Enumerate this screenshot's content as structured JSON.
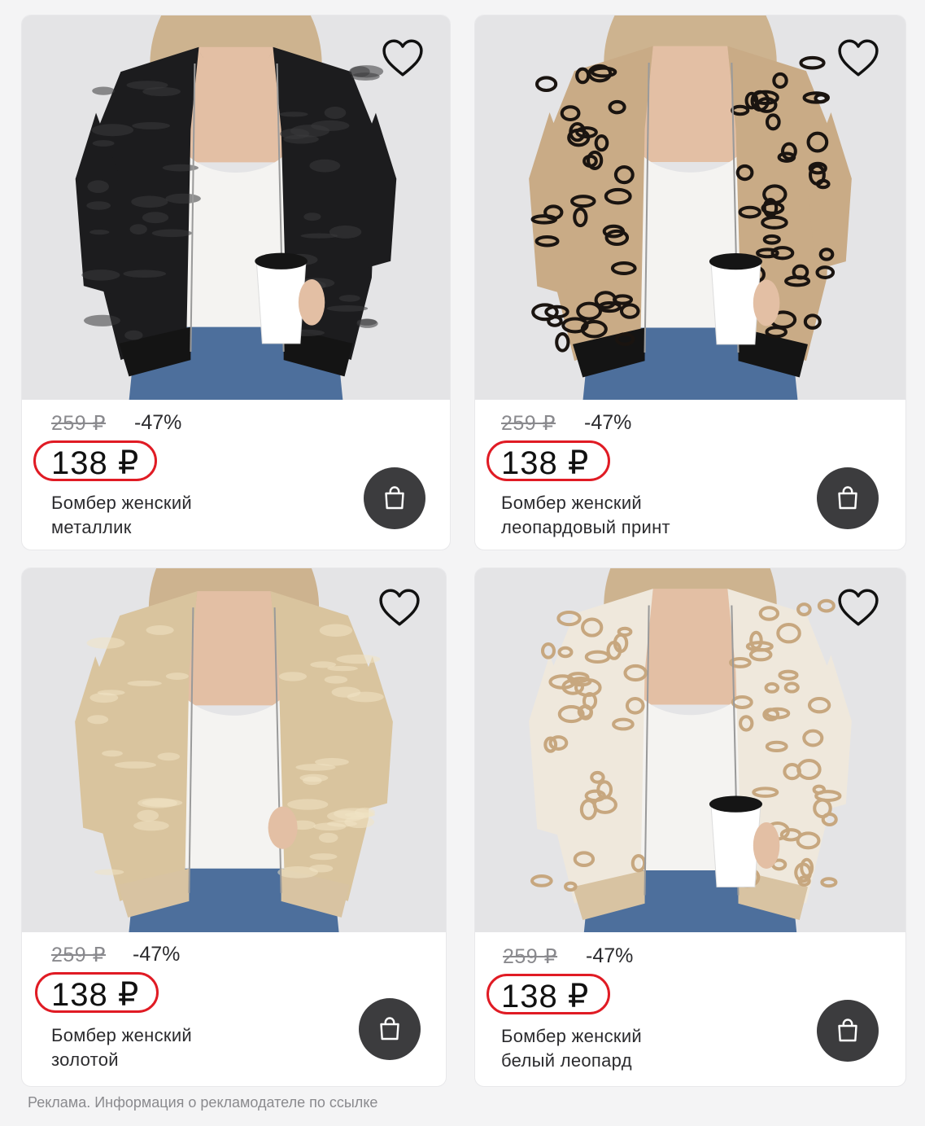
{
  "products": [
    {
      "old_price": "259 ₽",
      "discount": "-47%",
      "price": "138 ₽",
      "title_line1": "Бомбер женский",
      "title_line2": "металлик",
      "jacket_color": "#1c1c1e",
      "jacket_pattern": "metallic",
      "cup": true
    },
    {
      "old_price": "259 ₽",
      "discount": "-47%",
      "price": "138 ₽",
      "title_line1": "Бомбер женский",
      "title_line2": "леопардовый принт",
      "jacket_color": "#c9ab86",
      "jacket_pattern": "leopard-dark",
      "cup": true
    },
    {
      "old_price": "259 ₽",
      "discount": "-47%",
      "price": "138 ₽",
      "title_line1": "Бомбер женский",
      "title_line2": "золотой",
      "jacket_color": "#d9c49e",
      "jacket_pattern": "metallic",
      "cup": false
    },
    {
      "old_price": "259 ₽",
      "discount": "-47%",
      "price": "138 ₽",
      "title_line1": "Бомбер женский",
      "title_line2": "белый леопард",
      "jacket_color": "#efe8dc",
      "jacket_pattern": "leopard-light",
      "cup": true
    }
  ],
  "footer": {
    "ad_note": "Реклама. Информация о рекламодателе по ссылке"
  },
  "colors": {
    "price_ring": "#e01b24",
    "cart_button": "#3c3c3e",
    "background": "#f4f4f5"
  },
  "icons": {
    "favorite": "heart-outline-icon",
    "cart": "shopping-bag-icon"
  }
}
